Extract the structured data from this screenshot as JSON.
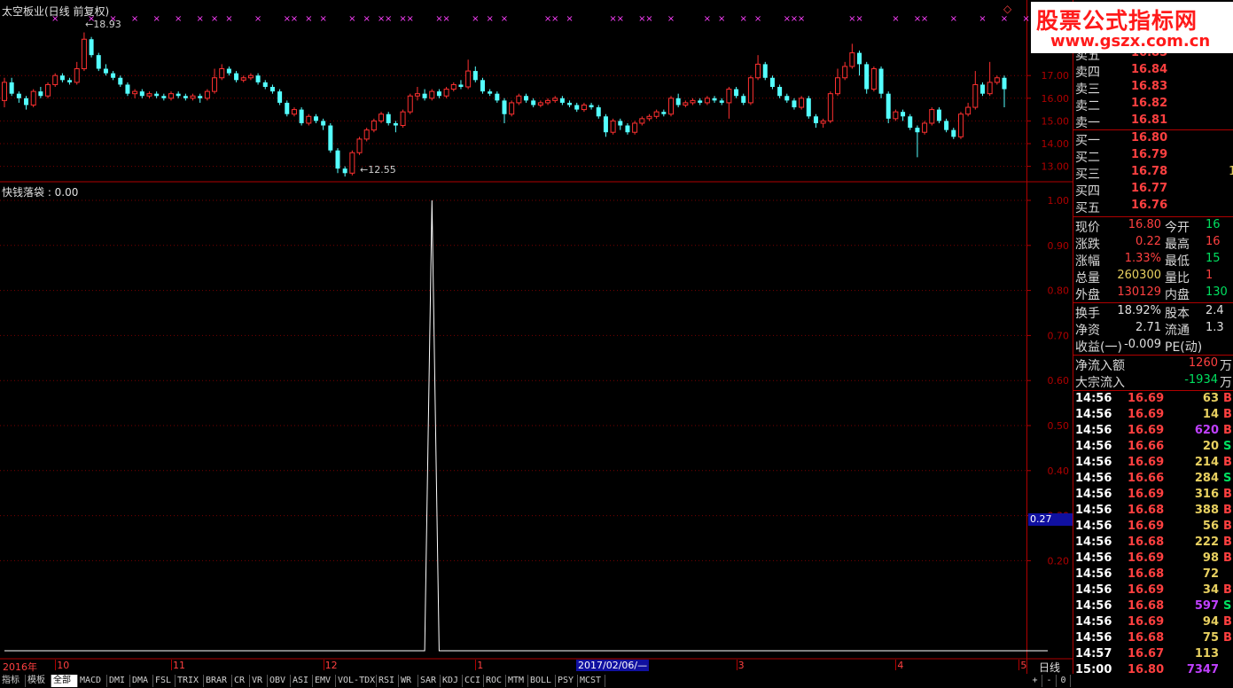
{
  "header": {
    "title": "太空板业(日线 前复权)",
    "corner_icon": "diamond-outline-icon"
  },
  "main_chart": {
    "high_label": "18.93",
    "low_label": "12.55",
    "y_ticks": [
      "17.00",
      "16.00",
      "15.00",
      "14.00",
      "13.00"
    ],
    "marker_glyph": "×",
    "candles": [
      [
        15.9,
        16.7,
        15.6,
        16.9
      ],
      [
        16.7,
        16.2,
        16.1,
        16.9
      ],
      [
        16.2,
        16.0,
        15.8,
        16.3
      ],
      [
        16.0,
        15.7,
        15.5,
        16.1
      ],
      [
        15.7,
        16.3,
        15.6,
        16.4
      ],
      [
        16.3,
        16.1,
        16.0,
        16.5
      ],
      [
        16.1,
        16.6,
        16.0,
        16.7
      ],
      [
        16.6,
        17.0,
        16.5,
        17.1
      ],
      [
        17.0,
        16.8,
        16.7,
        17.1
      ],
      [
        16.8,
        16.7,
        16.6,
        16.9
      ],
      [
        16.7,
        17.3,
        16.6,
        17.6
      ],
      [
        17.3,
        18.6,
        17.2,
        18.9
      ],
      [
        18.6,
        17.9,
        17.8,
        18.7
      ],
      [
        17.9,
        17.3,
        17.2,
        18.0
      ],
      [
        17.3,
        17.1,
        17.0,
        17.5
      ],
      [
        17.1,
        16.9,
        16.8,
        17.2
      ],
      [
        16.9,
        16.6,
        16.5,
        17.0
      ],
      [
        16.6,
        16.2,
        16.1,
        16.7
      ],
      [
        16.2,
        16.3,
        16.0,
        16.4
      ],
      [
        16.3,
        16.1,
        16.0,
        16.4
      ],
      [
        16.1,
        16.2,
        16.0,
        16.3
      ],
      [
        16.2,
        16.1,
        16.0,
        16.3
      ],
      [
        16.1,
        16.0,
        15.9,
        16.2
      ],
      [
        16.0,
        16.2,
        15.9,
        16.3
      ],
      [
        16.2,
        16.1,
        16.0,
        16.3
      ],
      [
        16.1,
        16.0,
        15.9,
        16.2
      ],
      [
        16.0,
        16.1,
        15.9,
        16.2
      ],
      [
        16.1,
        16.0,
        15.8,
        16.2
      ],
      [
        16.0,
        16.3,
        15.9,
        16.4
      ],
      [
        16.3,
        16.9,
        16.2,
        17.3
      ],
      [
        16.9,
        17.3,
        16.8,
        17.5
      ],
      [
        17.3,
        17.1,
        17.0,
        17.4
      ],
      [
        17.1,
        16.8,
        16.7,
        17.2
      ],
      [
        16.8,
        16.9,
        16.7,
        17.0
      ],
      [
        16.9,
        17.0,
        16.8,
        17.1
      ],
      [
        17.0,
        16.7,
        16.6,
        17.1
      ],
      [
        16.7,
        16.5,
        16.4,
        16.8
      ],
      [
        16.5,
        16.3,
        16.2,
        16.6
      ],
      [
        16.3,
        15.8,
        15.7,
        16.4
      ],
      [
        15.8,
        15.3,
        15.2,
        15.9
      ],
      [
        15.3,
        15.5,
        15.2,
        15.6
      ],
      [
        15.5,
        14.9,
        14.8,
        15.6
      ],
      [
        14.9,
        15.2,
        14.8,
        15.3
      ],
      [
        15.2,
        15.0,
        14.9,
        15.3
      ],
      [
        15.0,
        14.8,
        14.6,
        15.1
      ],
      [
        14.8,
        13.7,
        13.6,
        14.9
      ],
      [
        13.7,
        12.9,
        12.7,
        13.8
      ],
      [
        12.9,
        12.7,
        12.55,
        13.0
      ],
      [
        12.7,
        13.6,
        12.6,
        13.7
      ],
      [
        13.6,
        14.2,
        13.5,
        14.3
      ],
      [
        14.2,
        14.6,
        14.1,
        14.7
      ],
      [
        14.6,
        15.0,
        14.5,
        15.1
      ],
      [
        15.0,
        15.3,
        14.9,
        15.4
      ],
      [
        15.3,
        14.9,
        14.8,
        15.4
      ],
      [
        14.9,
        14.8,
        14.5,
        15.0
      ],
      [
        14.8,
        15.4,
        14.7,
        15.5
      ],
      [
        15.4,
        16.1,
        15.3,
        16.2
      ],
      [
        16.1,
        16.2,
        15.9,
        16.5
      ],
      [
        16.2,
        16.0,
        15.9,
        16.4
      ],
      [
        16.0,
        16.3,
        15.9,
        16.4
      ],
      [
        16.3,
        16.1,
        16.0,
        16.4
      ],
      [
        16.1,
        16.4,
        16.0,
        16.5
      ],
      [
        16.4,
        16.6,
        16.3,
        16.7
      ],
      [
        16.6,
        16.5,
        16.4,
        16.8
      ],
      [
        16.5,
        17.2,
        16.4,
        17.7
      ],
      [
        17.2,
        16.8,
        16.7,
        17.4
      ],
      [
        16.8,
        16.3,
        16.2,
        16.9
      ],
      [
        16.3,
        16.2,
        16.1,
        16.4
      ],
      [
        16.2,
        15.9,
        15.8,
        16.3
      ],
      [
        15.9,
        15.3,
        14.9,
        16.0
      ],
      [
        15.3,
        15.8,
        15.2,
        15.9
      ],
      [
        15.8,
        16.1,
        15.7,
        16.2
      ],
      [
        16.1,
        15.9,
        15.8,
        16.2
      ],
      [
        15.9,
        15.7,
        15.6,
        16.0
      ],
      [
        15.7,
        15.8,
        15.6,
        15.9
      ],
      [
        15.8,
        15.9,
        15.7,
        16.0
      ],
      [
        15.9,
        16.0,
        15.8,
        16.1
      ],
      [
        16.0,
        15.8,
        15.7,
        16.1
      ],
      [
        15.8,
        15.7,
        15.6,
        15.9
      ],
      [
        15.7,
        15.5,
        15.4,
        15.8
      ],
      [
        15.5,
        15.7,
        15.4,
        15.8
      ],
      [
        15.7,
        15.6,
        15.5,
        15.8
      ],
      [
        15.6,
        15.2,
        15.1,
        15.7
      ],
      [
        15.2,
        14.5,
        14.3,
        15.3
      ],
      [
        14.5,
        15.0,
        14.4,
        15.1
      ],
      [
        15.0,
        14.8,
        14.6,
        15.1
      ],
      [
        14.8,
        14.5,
        14.4,
        14.9
      ],
      [
        14.5,
        14.9,
        14.4,
        15.0
      ],
      [
        14.9,
        15.1,
        14.8,
        15.2
      ],
      [
        15.1,
        15.2,
        15.0,
        15.3
      ],
      [
        15.2,
        15.4,
        15.1,
        15.5
      ],
      [
        15.4,
        15.3,
        15.2,
        15.5
      ],
      [
        15.3,
        16.0,
        15.2,
        16.1
      ],
      [
        16.0,
        15.7,
        15.6,
        16.2
      ],
      [
        15.7,
        15.8,
        15.6,
        15.9
      ],
      [
        15.8,
        15.9,
        15.7,
        16.0
      ],
      [
        15.9,
        15.8,
        15.7,
        16.0
      ],
      [
        15.8,
        16.0,
        15.7,
        16.1
      ],
      [
        16.0,
        15.9,
        15.8,
        16.1
      ],
      [
        15.9,
        15.8,
        15.7,
        16.0
      ],
      [
        15.8,
        16.4,
        15.1,
        16.5
      ],
      [
        16.4,
        16.1,
        16.0,
        16.5
      ],
      [
        16.1,
        15.8,
        15.7,
        16.2
      ],
      [
        15.8,
        16.9,
        15.7,
        17.0
      ],
      [
        16.9,
        17.5,
        16.8,
        17.9
      ],
      [
        17.5,
        16.9,
        16.8,
        17.6
      ],
      [
        16.9,
        16.5,
        16.4,
        17.0
      ],
      [
        16.5,
        16.1,
        16.0,
        16.6
      ],
      [
        16.1,
        15.9,
        15.8,
        16.2
      ],
      [
        15.9,
        15.6,
        15.5,
        16.0
      ],
      [
        15.6,
        16.0,
        15.5,
        16.1
      ],
      [
        16.0,
        15.2,
        15.1,
        16.1
      ],
      [
        15.2,
        14.9,
        14.7,
        15.3
      ],
      [
        14.9,
        15.0,
        14.7,
        15.1
      ],
      [
        15.0,
        16.2,
        14.9,
        16.3
      ],
      [
        16.2,
        16.9,
        16.1,
        17.3
      ],
      [
        16.9,
        17.4,
        16.8,
        17.6
      ],
      [
        17.4,
        18.0,
        17.3,
        18.4
      ],
      [
        18.0,
        17.5,
        17.0,
        18.1
      ],
      [
        17.5,
        16.4,
        16.2,
        17.6
      ],
      [
        16.4,
        17.3,
        16.3,
        17.4
      ],
      [
        17.3,
        16.2,
        16.0,
        17.4
      ],
      [
        16.2,
        15.1,
        14.9,
        16.3
      ],
      [
        15.1,
        15.4,
        15.0,
        15.5
      ],
      [
        15.4,
        15.2,
        15.0,
        15.5
      ],
      [
        15.2,
        14.7,
        14.6,
        15.3
      ],
      [
        14.7,
        14.5,
        13.4,
        14.8
      ],
      [
        14.5,
        14.9,
        14.4,
        15.0
      ],
      [
        14.9,
        15.5,
        14.8,
        15.6
      ],
      [
        15.5,
        15.0,
        14.9,
        15.6
      ],
      [
        15.0,
        14.6,
        14.5,
        15.1
      ],
      [
        14.6,
        14.3,
        14.2,
        14.7
      ],
      [
        14.3,
        15.3,
        14.2,
        15.4
      ],
      [
        15.3,
        15.6,
        15.2,
        15.8
      ],
      [
        15.6,
        16.6,
        15.5,
        17.2
      ],
      [
        16.6,
        16.2,
        16.1,
        16.7
      ],
      [
        16.2,
        16.7,
        16.1,
        17.6
      ],
      [
        16.7,
        16.9,
        16.6,
        17.0
      ],
      [
        16.9,
        16.4,
        15.6,
        17.0
      ]
    ],
    "marker_index": [
      7,
      12,
      15,
      18,
      21,
      24,
      27,
      29,
      31,
      35,
      39,
      40,
      42,
      44,
      48,
      50,
      52,
      53,
      55,
      56,
      60,
      61,
      65,
      67,
      69,
      75,
      76,
      78,
      84,
      85,
      88,
      89,
      92,
      97,
      99,
      102,
      104,
      108,
      109,
      110,
      117,
      118,
      123,
      126,
      127,
      131,
      135,
      138,
      141,
      142
    ]
  },
  "indicator": {
    "title": "快钱落袋 : 0.00",
    "y_ticks": [
      "1.00",
      "0.90",
      "0.80",
      "0.70",
      "0.60",
      "0.50",
      "0.40",
      "0.30",
      "0.20"
    ],
    "cursor_value": "0.27",
    "values": [
      0,
      0,
      0,
      0,
      0,
      0,
      0,
      0,
      0,
      0,
      0,
      0,
      0,
      0,
      0,
      0,
      0,
      0,
      0,
      0,
      0,
      0,
      0,
      0,
      0,
      0,
      0,
      0,
      0,
      0,
      0,
      0,
      0,
      0,
      0,
      0,
      0,
      0,
      0,
      0,
      0,
      0,
      0,
      0,
      0,
      0,
      0,
      0,
      0,
      0,
      0,
      0,
      0,
      0,
      0,
      0,
      0,
      0,
      0,
      1,
      0,
      0,
      0,
      0,
      0,
      0,
      0,
      0,
      0,
      0,
      0,
      0,
      0,
      0,
      0,
      0,
      0,
      0,
      0,
      0,
      0,
      0,
      0,
      0,
      0,
      0,
      0,
      0,
      0,
      0,
      0,
      0,
      0,
      0,
      0,
      0,
      0,
      0,
      0,
      0,
      0,
      0,
      0,
      0,
      0,
      0,
      0,
      0,
      0,
      0,
      0,
      0,
      0,
      0,
      0,
      0,
      0,
      0,
      0,
      0,
      0,
      0,
      0,
      0,
      0,
      0,
      0,
      0,
      0,
      0,
      0,
      0,
      0,
      0,
      0,
      0,
      0,
      0,
      0,
      0,
      0,
      0,
      0,
      0,
      0
    ]
  },
  "date_axis": {
    "labels": [
      {
        "text": "2016年",
        "pos": 0
      },
      {
        "text": "10",
        "pos": 7
      },
      {
        "text": "11",
        "pos": 23
      },
      {
        "text": "12",
        "pos": 44
      },
      {
        "text": "1",
        "pos": 65
      },
      {
        "text": "3",
        "pos": 101
      },
      {
        "text": "4",
        "pos": 123
      },
      {
        "text": "5",
        "pos": 140
      }
    ],
    "cursor_date": "2017/02/06/—",
    "period": "日线"
  },
  "tabs": [
    "指标",
    "模板",
    "全部",
    "MACD",
    "DMI",
    "DMA",
    "FSL",
    "TRIX",
    "BRAR",
    "CR",
    "VR",
    "OBV",
    "ASI",
    "EMV",
    "VOL-TDX",
    "RSI",
    "WR",
    "SAR",
    "KDJ",
    "CCI",
    "ROC",
    "MTM",
    "BOLL",
    "PSY",
    "MCST"
  ],
  "tabs_active": "全部",
  "zoom": [
    "+",
    "-",
    "0"
  ],
  "watermark": {
    "line1": "股票公式指标网",
    "line2": "www.gszx.com.cn"
  },
  "quote": {
    "order_book": [
      {
        "label": "卖五",
        "price": "16.85",
        "vol": ""
      },
      {
        "label": "卖四",
        "price": "16.84",
        "vol": ""
      },
      {
        "label": "卖三",
        "price": "16.83",
        "vol": ""
      },
      {
        "label": "卖二",
        "price": "16.82",
        "vol": ""
      },
      {
        "label": "卖一",
        "price": "16.81",
        "vol": ""
      },
      {
        "label": "买一",
        "price": "16.80",
        "vol": ""
      },
      {
        "label": "买二",
        "price": "16.79",
        "vol": ""
      },
      {
        "label": "买三",
        "price": "16.78",
        "vol": "1"
      },
      {
        "label": "买四",
        "price": "16.77",
        "vol": ""
      },
      {
        "label": "买五",
        "price": "16.76",
        "vol": ""
      }
    ],
    "stats": [
      {
        "l1": "现价",
        "v1": "16.80",
        "c1": "#ff4040",
        "l2": "今开",
        "v2": "16",
        "c2": "#00e060"
      },
      {
        "l1": "涨跌",
        "v1": "0.22",
        "c1": "#ff4040",
        "l2": "最高",
        "v2": "16",
        "c2": "#ff4040"
      },
      {
        "l1": "涨幅",
        "v1": "1.33%",
        "c1": "#ff4040",
        "l2": "最低",
        "v2": "15",
        "c2": "#00e060"
      },
      {
        "l1": "总量",
        "v1": "260300",
        "c1": "#e8d060",
        "l2": "量比",
        "v2": "1",
        "c2": "#ff4040"
      },
      {
        "l1": "外盘",
        "v1": "130129",
        "c1": "#ff4040",
        "l2": "内盘",
        "v2": "130",
        "c2": "#00e060"
      }
    ],
    "fund": [
      {
        "l1": "换手",
        "v1": "18.92%",
        "l2": "股本",
        "v2": "2.4"
      },
      {
        "l1": "净资",
        "v1": "2.71",
        "l2": "流通",
        "v2": "1.3"
      },
      {
        "l1": "收益(一)",
        "v1": "-0.009",
        "l2": "PE(动)",
        "v2": ""
      }
    ],
    "flows": [
      {
        "label": "净流入额",
        "value": "1260",
        "unit": "万",
        "color": "#ff4040"
      },
      {
        "label": "大宗流入",
        "value": "-1934",
        "unit": "万",
        "color": "#00e060"
      }
    ],
    "ticks": [
      {
        "t": "14:56",
        "p": "16.69",
        "v": "63",
        "s": "B",
        "vc": "#e8d060"
      },
      {
        "t": "14:56",
        "p": "16.69",
        "v": "14",
        "s": "B",
        "vc": "#e8d060"
      },
      {
        "t": "14:56",
        "p": "16.69",
        "v": "620",
        "s": "B",
        "vc": "#c040ff"
      },
      {
        "t": "14:56",
        "p": "16.66",
        "v": "20",
        "s": "S",
        "vc": "#e8d060"
      },
      {
        "t": "14:56",
        "p": "16.69",
        "v": "214",
        "s": "B",
        "vc": "#e8d060"
      },
      {
        "t": "14:56",
        "p": "16.66",
        "v": "284",
        "s": "S",
        "vc": "#e8d060"
      },
      {
        "t": "14:56",
        "p": "16.69",
        "v": "316",
        "s": "B",
        "vc": "#e8d060"
      },
      {
        "t": "14:56",
        "p": "16.68",
        "v": "388",
        "s": "B",
        "vc": "#e8d060"
      },
      {
        "t": "14:56",
        "p": "16.69",
        "v": "56",
        "s": "B",
        "vc": "#e8d060"
      },
      {
        "t": "14:56",
        "p": "16.68",
        "v": "222",
        "s": "B",
        "vc": "#e8d060"
      },
      {
        "t": "14:56",
        "p": "16.69",
        "v": "98",
        "s": "B",
        "vc": "#e8d060"
      },
      {
        "t": "14:56",
        "p": "16.68",
        "v": "72",
        "s": "",
        "vc": "#e8d060"
      },
      {
        "t": "14:56",
        "p": "16.69",
        "v": "34",
        "s": "B",
        "vc": "#e8d060"
      },
      {
        "t": "14:56",
        "p": "16.68",
        "v": "597",
        "s": "S",
        "vc": "#c040ff"
      },
      {
        "t": "14:56",
        "p": "16.69",
        "v": "94",
        "s": "B",
        "vc": "#e8d060"
      },
      {
        "t": "14:56",
        "p": "16.68",
        "v": "75",
        "s": "B",
        "vc": "#e8d060"
      },
      {
        "t": "14:57",
        "p": "16.67",
        "v": "113",
        "s": "",
        "vc": "#e8d060"
      },
      {
        "t": "15:00",
        "p": "16.80",
        "v": "7347",
        "s": "",
        "vc": "#c040ff"
      }
    ]
  },
  "colors": {
    "up": "#ff3030",
    "down": "#54ffff",
    "frame": "#b00000",
    "grid": "#7a0000",
    "marker": "#ff40ff",
    "indicator_line": "#ffffff"
  }
}
